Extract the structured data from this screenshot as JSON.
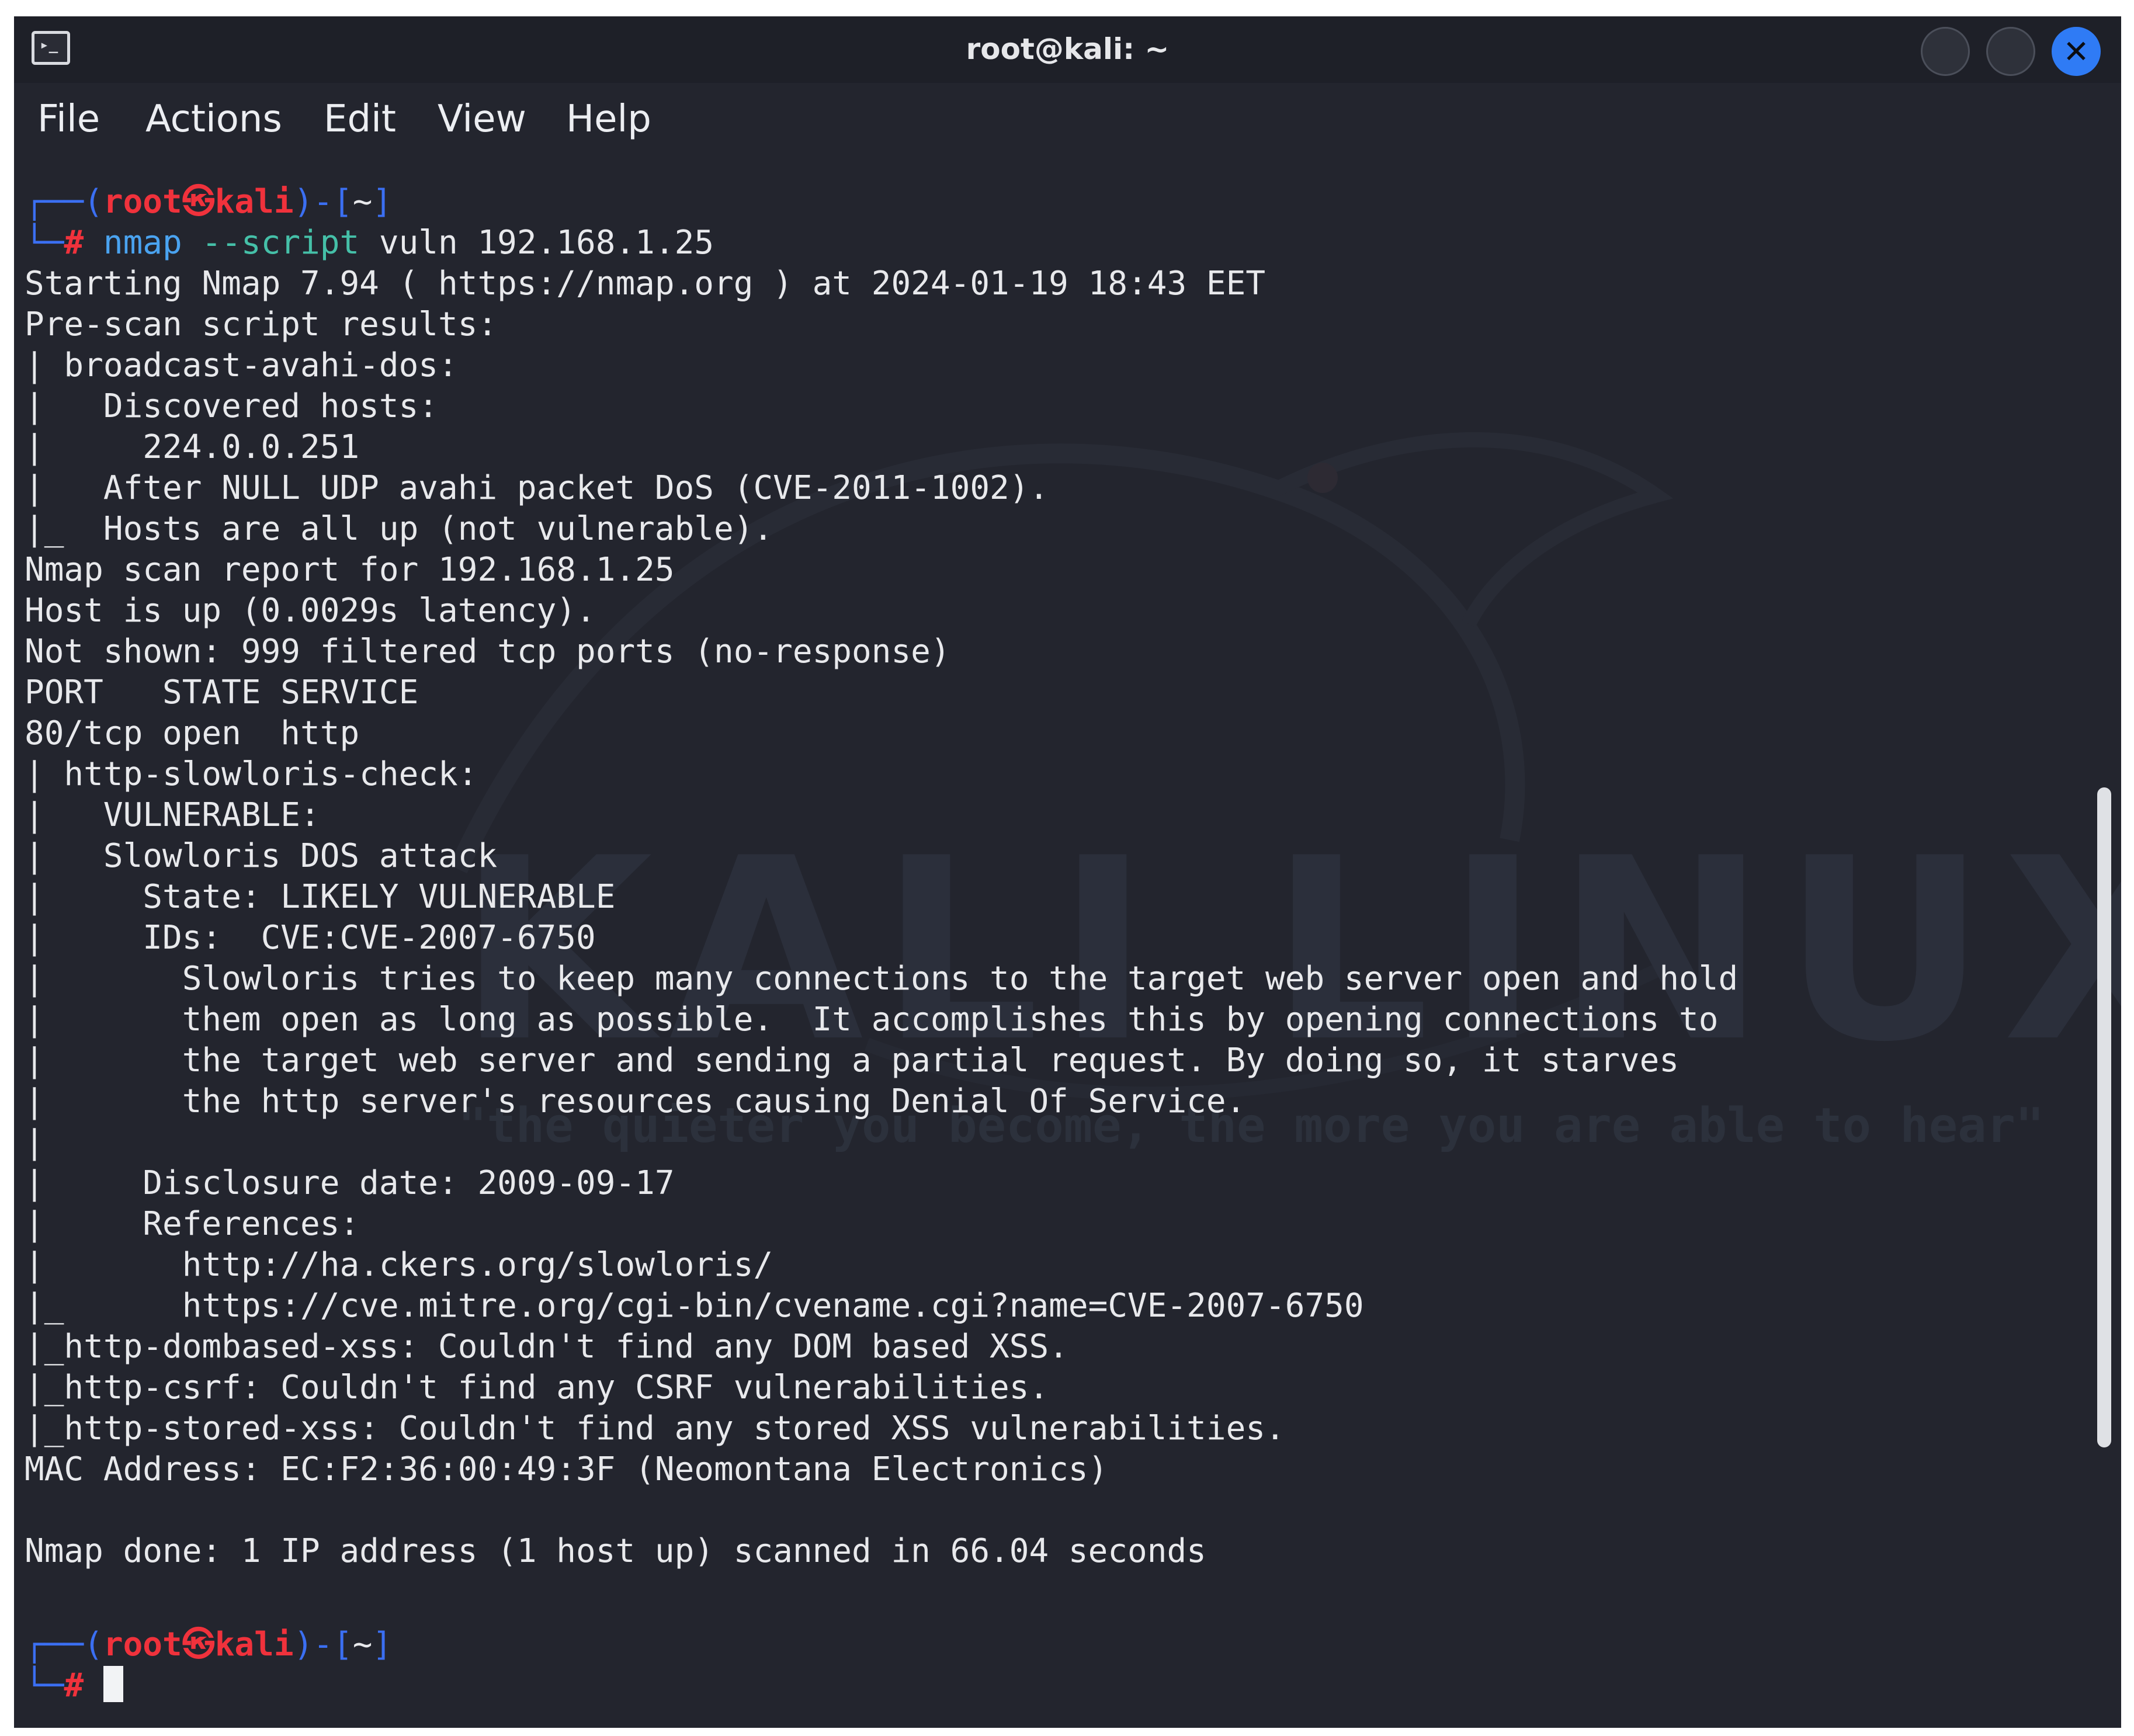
{
  "window": {
    "title": "root@kali: ~",
    "close_glyph": "✕",
    "icon": "terminal-icon",
    "colors": {
      "background": "#23252e",
      "accent": "#2f7bf5",
      "prompt_user": "#f0323c",
      "prompt_frame": "#3b6ff2"
    }
  },
  "menu": [
    "File",
    "Actions",
    "Edit",
    "View",
    "Help"
  ],
  "prompt": {
    "open": "┌──(",
    "user": "root",
    "at": "㉿",
    "host": "kali",
    "close": ")-[",
    "dir": "~",
    "end": "]",
    "corner": "└─",
    "hash": "#"
  },
  "command": {
    "program": "nmap",
    "flag": "--script",
    "args": "vuln 192.168.1.25"
  },
  "output": [
    "Starting Nmap 7.94 ( https://nmap.org ) at 2024-01-19 18:43 EET",
    "Pre-scan script results:",
    "| broadcast-avahi-dos:",
    "|   Discovered hosts:",
    "|     224.0.0.251",
    "|   After NULL UDP avahi packet DoS (CVE-2011-1002).",
    "|_  Hosts are all up (not vulnerable).",
    "Nmap scan report for 192.168.1.25",
    "Host is up (0.0029s latency).",
    "Not shown: 999 filtered tcp ports (no-response)",
    "PORT   STATE SERVICE",
    "80/tcp open  http",
    "| http-slowloris-check:",
    "|   VULNERABLE:",
    "|   Slowloris DOS attack",
    "|     State: LIKELY VULNERABLE",
    "|     IDs:  CVE:CVE-2007-6750",
    "|       Slowloris tries to keep many connections to the target web server open and hold",
    "|       them open as long as possible.  It accomplishes this by opening connections to",
    "|       the target web server and sending a partial request. By doing so, it starves",
    "|       the http server's resources causing Denial Of Service.",
    "|",
    "|     Disclosure date: 2009-09-17",
    "|     References:",
    "|       http://ha.ckers.org/slowloris/",
    "|_      https://cve.mitre.org/cgi-bin/cvename.cgi?name=CVE-2007-6750",
    "|_http-dombased-xss: Couldn't find any DOM based XSS.",
    "|_http-csrf: Couldn't find any CSRF vulnerabilities.",
    "|_http-stored-xss: Couldn't find any stored XSS vulnerabilities.",
    "MAC Address: EC:F2:36:00:49:3F (Neomontana Electronics)",
    "",
    "Nmap done: 1 IP address (1 host up) scanned in 66.04 seconds"
  ],
  "watermark": {
    "brand": "KALI LINUX",
    "quote": "\"the quieter you become, the more you are able to hear\""
  }
}
